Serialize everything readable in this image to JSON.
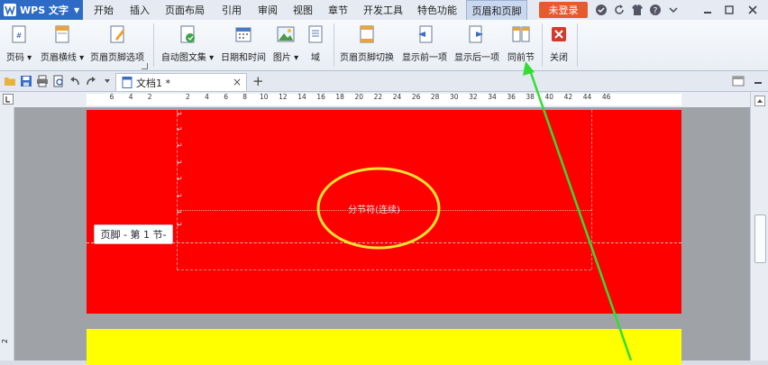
{
  "app": {
    "name": "WPS 文字",
    "logo_icon": "wps-logo-icon"
  },
  "menu": {
    "items": [
      {
        "label": "开始"
      },
      {
        "label": "插入"
      },
      {
        "label": "页面布局"
      },
      {
        "label": "引用"
      },
      {
        "label": "审阅"
      },
      {
        "label": "视图"
      },
      {
        "label": "章节"
      },
      {
        "label": "开发工具"
      },
      {
        "label": "特色功能"
      },
      {
        "label": "页眉和页脚",
        "active": true
      }
    ],
    "login": "未登录"
  },
  "ribbon": {
    "buttons": [
      {
        "label": "页码 ▾",
        "icon": "page-number-icon"
      },
      {
        "label": "页眉横线 ▾",
        "icon": "header-line-icon"
      },
      {
        "label": "页眉页脚选项",
        "icon": "header-footer-options-icon"
      },
      {
        "label": "自动图文集 ▾",
        "icon": "autotext-icon"
      },
      {
        "label": "日期和时间",
        "icon": "date-time-icon"
      },
      {
        "label": "图片 ▾",
        "icon": "picture-icon"
      },
      {
        "label": "域",
        "icon": "field-icon"
      },
      {
        "label": "页眉页脚切换",
        "icon": "switch-header-footer-icon"
      },
      {
        "label": "显示前一项",
        "icon": "show-previous-icon"
      },
      {
        "label": "显示后一项",
        "icon": "show-next-icon"
      },
      {
        "label": "同前节",
        "icon": "link-to-previous-icon"
      },
      {
        "label": "关闭",
        "icon": "close-icon"
      }
    ]
  },
  "doc_tab": {
    "title": "文档1 *",
    "close": "×",
    "add": "+"
  },
  "ruler": {
    "ticks": [
      "6",
      "4",
      "2",
      "",
      "2",
      "4",
      "6",
      "8",
      "10",
      "12",
      "14",
      "16",
      "18",
      "20",
      "22",
      "24",
      "26",
      "28",
      "30",
      "32",
      "34",
      "36",
      "38",
      "40",
      "42",
      "44",
      "46"
    ]
  },
  "document": {
    "footer_tag": "页脚 - 第 1 节-",
    "section_break": "分节符(连续)",
    "paragraph_mark": "↵",
    "vertical_ruler_number": "2"
  },
  "colors": {
    "page_red": "#fe0000",
    "page_yellow": "#ffff00",
    "annotation_circle": "#ffe033",
    "annotation_arrow": "#33dd33",
    "login": "#e65a2f",
    "app_blue": "#2e6bc7"
  }
}
